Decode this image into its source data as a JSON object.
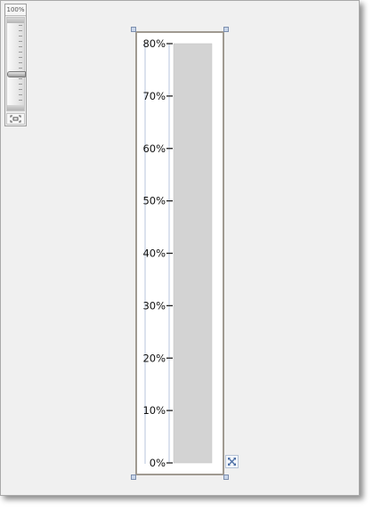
{
  "zoom": {
    "label": "100%",
    "level_percent": 62
  },
  "chart_data": {
    "type": "bar",
    "orientation": "vertical",
    "categories": [
      ""
    ],
    "values": [
      80
    ],
    "ylim": [
      0,
      80
    ],
    "yticks": [
      "0%",
      "10%",
      "20%",
      "30%",
      "40%",
      "50%",
      "60%",
      "70%",
      "80%"
    ],
    "ytick_values": [
      0,
      10,
      20,
      30,
      40,
      50,
      60,
      70,
      80
    ],
    "grid": false,
    "colors": {
      "bar": "#d3d3d3",
      "axis": "#b7c6dc",
      "tick": "#222222"
    }
  },
  "icons": {
    "zoom_fit": "fit-screen-icon",
    "expand": "expand-arrows-icon"
  }
}
